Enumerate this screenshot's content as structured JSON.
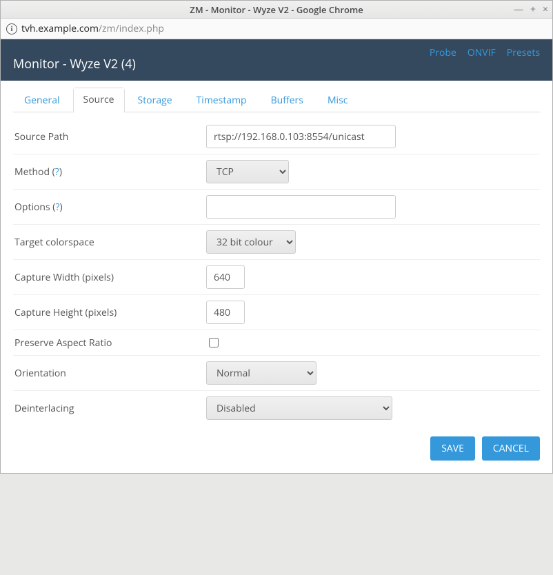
{
  "window": {
    "title": "ZM - Monitor - Wyze V2 - Google Chrome"
  },
  "address": {
    "host": "tvh.example.com",
    "path": "/zm/index.php"
  },
  "header": {
    "title": "Monitor - Wyze V2 (4)",
    "links": {
      "probe": "Probe",
      "onvif": "ONVIF",
      "presets": "Presets"
    }
  },
  "tabs": {
    "general": "General",
    "source": "Source",
    "storage": "Storage",
    "timestamp": "Timestamp",
    "buffers": "Buffers",
    "misc": "Misc",
    "active": "source"
  },
  "form": {
    "source_path": {
      "label": "Source Path",
      "value": "rtsp://192.168.0.103:8554/unicast"
    },
    "method": {
      "label": "Method",
      "help": "?",
      "value": "TCP"
    },
    "options": {
      "label": "Options",
      "help": "?",
      "value": ""
    },
    "target_colorspace": {
      "label": "Target colorspace",
      "value": "32 bit colour"
    },
    "capture_width": {
      "label": "Capture Width (pixels)",
      "value": "640"
    },
    "capture_height": {
      "label": "Capture Height (pixels)",
      "value": "480"
    },
    "preserve_aspect": {
      "label": "Preserve Aspect Ratio",
      "checked": false
    },
    "orientation": {
      "label": "Orientation",
      "value": "Normal"
    },
    "deinterlacing": {
      "label": "Deinterlacing",
      "value": "Disabled"
    }
  },
  "buttons": {
    "save": "SAVE",
    "cancel": "CANCEL"
  }
}
